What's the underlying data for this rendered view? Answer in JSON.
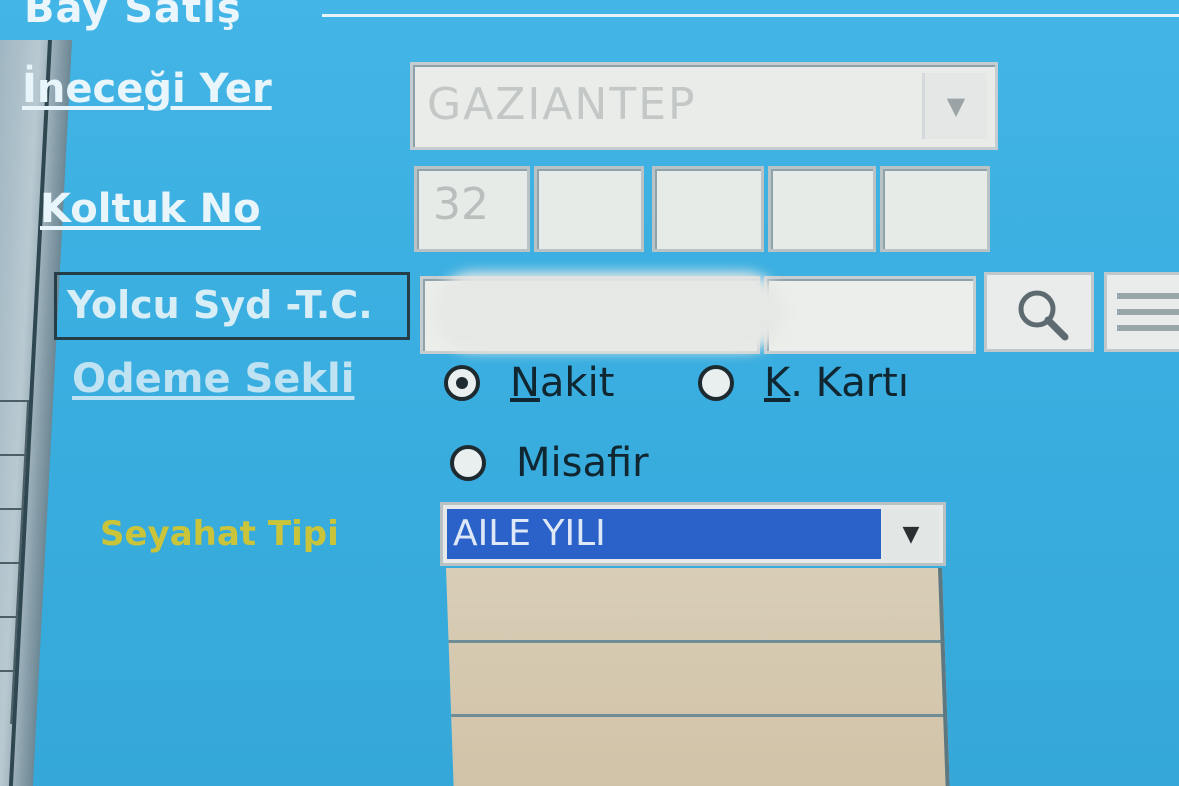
{
  "group": {
    "title": "Bay Satış"
  },
  "destination": {
    "label": "İneceği Yer",
    "value": "GAZIANTEP"
  },
  "seat": {
    "label": "Koltuk No",
    "values": [
      "32",
      "",
      "",
      "",
      ""
    ]
  },
  "id_field": {
    "label": "Yolcu Syd -T.C.",
    "value": ""
  },
  "payment": {
    "label": "Odeme Sekli",
    "options": [
      {
        "label_hot": "N",
        "label_rest": "akit",
        "selected": true
      },
      {
        "label_hot": "K",
        "label_rest": ". Kartı",
        "selected": false
      },
      {
        "label_hot": "",
        "label_rest": "Misafir",
        "selected": false
      }
    ]
  },
  "discount": {
    "label": "Seyahat Tipi",
    "selected": "AILE YILI"
  },
  "colors": {
    "background": "#3aaee0",
    "selection": "#2b62c9",
    "label_yellow": "#c9c43a"
  }
}
